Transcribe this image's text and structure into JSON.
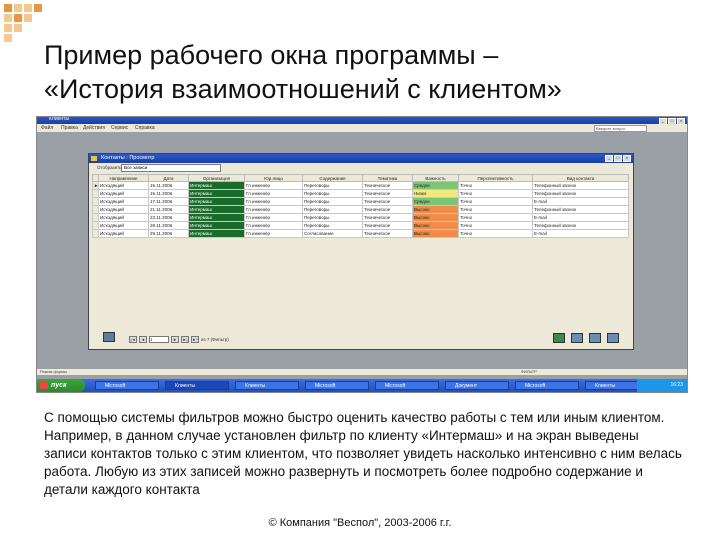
{
  "slide": {
    "title_line1": "Пример рабочего окна программы –",
    "title_line2": "«История взаимоотношений с клиентом»",
    "description": "С помощью системы фильтров можно быстро оценить качество работы с тем или иным клиентом. Например, в данном случае установлен фильтр по клиенту «Интермаш» и на экран выведены записи контактов только с этим клиентом, что позволяет увидеть насколько интенсивно с ним велась работа. Любую из этих записей можно развернуть и посмотреть более подробно содержание и детали каждого контакта",
    "footer": "© Компания \"Веспол\", 2003-2006 г.г."
  },
  "app": {
    "title": "Клиенты",
    "menu": [
      "Файл",
      "Правка",
      "Действия",
      "Сервис",
      "Справка"
    ],
    "menu_hint": "Введите вопрос"
  },
  "window": {
    "title": "Контакты : Просмотр",
    "filter_label": "Отобразить",
    "filter_value": "Все записи"
  },
  "table": {
    "columns": [
      "Направление",
      "Дата",
      "Организация",
      "Юр.лицо",
      "Содержание",
      "Тематика",
      "Важность",
      "Перспективность",
      "Вид контакта"
    ],
    "rows": [
      [
        "Исходящий",
        "15.11.2006",
        "Интермаш",
        "Гл.инженер",
        "Переговоры",
        "Техническое",
        "Средне",
        "Точно",
        "Телефонный звонок"
      ],
      [
        "Исходящий",
        "15.11.2006",
        "Интермаш",
        "Гл.инженер",
        "Переговоры",
        "Техническое",
        "Низко",
        "Точно",
        "Телефонный звонок"
      ],
      [
        "Исходящий",
        "17.11.2006",
        "Интермаш",
        "Гл.инженер",
        "Переговоры",
        "Техническое",
        "Средне",
        "Точно",
        "E-mail"
      ],
      [
        "Исходящий",
        "21.11.2006",
        "Интермаш",
        "Гл.инженер",
        "Переговоры",
        "Техническое",
        "Высоко",
        "Точно",
        "Телефонный звонок"
      ],
      [
        "Исходящий",
        "23.11.2006",
        "Интермаш",
        "Гл.инженер",
        "Переговоры",
        "Техническое",
        "Высоко",
        "Точно",
        "E-mail"
      ],
      [
        "Исходящий",
        "28.11.2006",
        "Интермаш",
        "Гл.инженер",
        "Переговоры",
        "Техническое",
        "Высоко",
        "Точно",
        "Телефонный звонок"
      ],
      [
        "Исходящий",
        "29.11.2006",
        "Интермаш",
        "Гл.инженер",
        "Согласование",
        "Техническое",
        "Высоко",
        "Точно",
        "E-mail"
      ]
    ],
    "importance_colors": [
      "green",
      "yellow",
      "green",
      "orange",
      "orange",
      "orange",
      "orange"
    ]
  },
  "navigator": {
    "current": "1",
    "total_label": "из 7 (Фильтр)"
  },
  "statusbar": {
    "left": "Режим формы",
    "right": "ФИЛЬТР"
  },
  "taskbar": {
    "start": "пуск",
    "tasks": [
      "Microsoft",
      "Клиенты",
      "Клиенты",
      "Microsoft",
      "Microsoft",
      "Документ",
      "Microsoft",
      "Клиенты"
    ],
    "clock": "16:23"
  },
  "colors": {
    "titlebar": "#1a3fa6",
    "accent_deco": "#f5c890",
    "accent_deco_dark": "#e8963c"
  }
}
